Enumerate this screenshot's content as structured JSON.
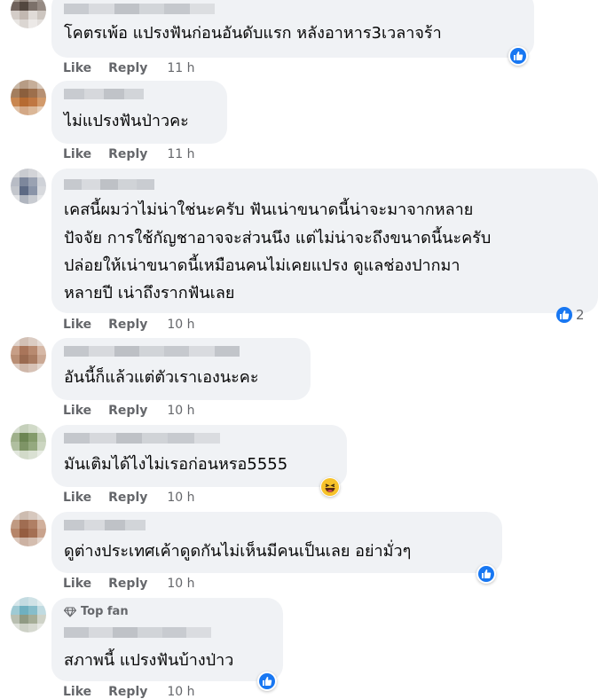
{
  "colors": {
    "bubble_bg": "#f0f2f5",
    "like_blue": "#1877f2",
    "meta_gray": "#65676b",
    "text_dark": "#050505"
  },
  "comments": [
    {
      "lines": [
        "โคตรเพ้อ แปรงฟันก่อนอันดับแรก หลังอาหาร3เวลาจร้า"
      ],
      "like_label": "Like",
      "reply_label": "Reply",
      "time": "11 h",
      "reaction": "like-icon",
      "reaction_count": ""
    },
    {
      "lines": [
        "ไม่แปรงฟันป่าวคะ"
      ],
      "like_label": "Like",
      "reply_label": "Reply",
      "time": "11 h",
      "reaction": "",
      "reaction_count": ""
    },
    {
      "lines": [
        "เคสนี้ผมว่าไม่น่าใช่นะครับ ฟันเน่าขนาดนี้น่าจะมาจากหลาย",
        "ปัจจัย การใช้กัญชาอาจจะส่วนนึง แต่ไม่น่าจะถึงขนาดนี้นะครับ",
        "ปล่อยให้เน่าขนาดนี้เหมือนคนไม่เคยแปรง ดูแลช่องปากมา",
        "หลายปี เน่าถึงรากฟันเลย"
      ],
      "like_label": "Like",
      "reply_label": "Reply",
      "time": "10 h",
      "reaction": "like-icon",
      "reaction_count": "2"
    },
    {
      "lines": [
        "อันนี้ก็แล้วแต่ตัวเราเองนะคะ"
      ],
      "like_label": "Like",
      "reply_label": "Reply",
      "time": "10 h",
      "reaction": "",
      "reaction_count": ""
    },
    {
      "lines": [
        "มันเติมได้ไงไม่เรอก่อนหรอ5555"
      ],
      "like_label": "Like",
      "reply_label": "Reply",
      "time": "10 h",
      "reaction": "haha-icon",
      "reaction_count": ""
    },
    {
      "lines": [
        "ดูต่างประเทศเค้าดูดกันไม่เห็นมีคนเป็นเลย อย่ามั่วๆ"
      ],
      "like_label": "Like",
      "reply_label": "Reply",
      "time": "10 h",
      "reaction": "like-icon",
      "reaction_count": ""
    },
    {
      "badge": "Top fan",
      "badge_icon": "diamond-icon",
      "lines": [
        "สภาพนี้ แปรงฟันบ้างป่าว"
      ],
      "like_label": "Like",
      "reply_label": "Reply",
      "time": "10 h",
      "reaction": "like-icon",
      "reaction_count": ""
    }
  ]
}
